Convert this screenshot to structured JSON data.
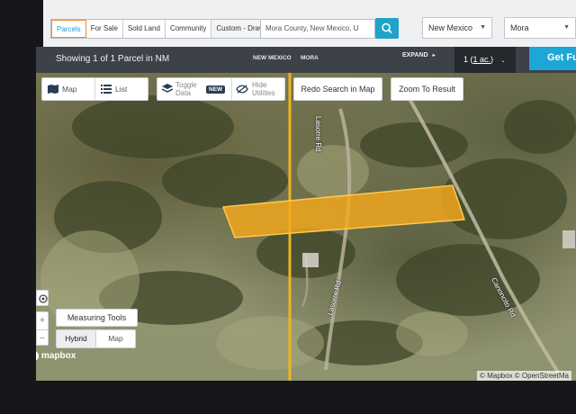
{
  "filters": {
    "tabs": [
      {
        "label": "Parcels",
        "active": true
      },
      {
        "label": "For Sale",
        "active": false
      },
      {
        "label": "Sold Land",
        "active": false
      },
      {
        "label": "Community",
        "active": false
      },
      {
        "label": "Custom - Draw",
        "active": false
      }
    ],
    "search_value": "Mora County, New Mexico, U",
    "state_select": "New Mexico",
    "county_select": "Mora"
  },
  "status": {
    "showing_text": "Showing 1 of 1 Parcel in NM",
    "breadcrumb": [
      "NEW MEXICO",
      "MORA"
    ],
    "expand_label": "EXPAND",
    "count_prefix": "1 (",
    "count_unit": "1 ac.",
    "count_suffix": ")",
    "get_full_label": "Get Fu"
  },
  "map_controls": {
    "map_label": "Map",
    "list_label": "List",
    "toggle_data_line1": "Toggle",
    "toggle_data_line2": "Data",
    "new_badge": "NEW",
    "hide_utilities_line1": "Hide",
    "hide_utilities_line2": "Utilities",
    "redo_search": "Redo Search in Map",
    "zoom_to_result": "Zoom To Result",
    "zoom_in": "+",
    "zoom_out": "−",
    "measuring_tools": "Measuring Tools",
    "layer_options": [
      "Hybrid",
      "Map"
    ],
    "active_layer": "Hybrid"
  },
  "map": {
    "roads": [
      "Lasorre Rd",
      "Lasorre Rd",
      "Canoncito Rd"
    ],
    "logo": "mapbox",
    "attribution": "© Mapbox © OpenStreetMa"
  },
  "colors": {
    "parcel_fill": "#f5a81c",
    "boundary_line": "#f0b41e",
    "accent": "#1ea6d6"
  }
}
